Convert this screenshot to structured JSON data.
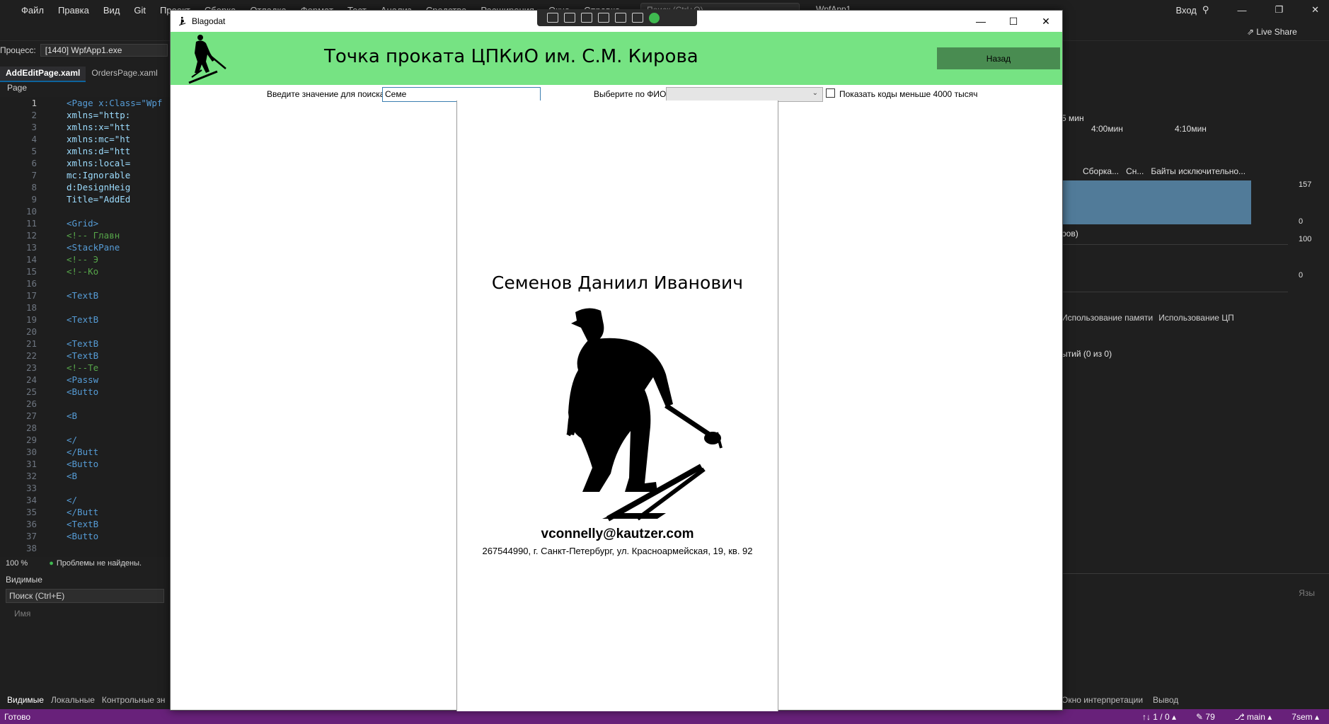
{
  "vs": {
    "menu": [
      "Файл",
      "Правка",
      "Вид",
      "Git",
      "Проект",
      "Сборка",
      "Отладка",
      "Формат",
      "Тест",
      "Анализ",
      "Средства",
      "Расширения",
      "Окно",
      "Справка"
    ],
    "search_placeholder": "Поиск (Ctrl+Q)",
    "solution": "WpfApp1",
    "signin": "Вход",
    "live_share": "Live Share",
    "process_label": "Процесс:",
    "process_value": "[1440] WpfApp1.exe",
    "tab_active": "AddEditPage.xaml",
    "tab_other": "OrdersPage.xaml",
    "breadcrumb": "Page",
    "code_lines": [
      {
        "n": "1",
        "t": "<Page x:Class=\"Wpf"
      },
      {
        "n": "2",
        "t": "      xmlns=\"http:"
      },
      {
        "n": "3",
        "t": "      xmlns:x=\"htt"
      },
      {
        "n": "4",
        "t": "      xmlns:mc=\"ht"
      },
      {
        "n": "5",
        "t": "      xmlns:d=\"htt"
      },
      {
        "n": "6",
        "t": "      xmlns:local="
      },
      {
        "n": "7",
        "t": "      mc:Ignorable"
      },
      {
        "n": "8",
        "t": "      d:DesignHeig"
      },
      {
        "n": "9",
        "t": "      Title=\"AddEd"
      },
      {
        "n": "10",
        "t": ""
      },
      {
        "n": "11",
        "t": "  <Grid>"
      },
      {
        "n": "12",
        "t": "    <!-- Главн"
      },
      {
        "n": "13",
        "t": "    <StackPane"
      },
      {
        "n": "14",
        "t": "      <!-- Э"
      },
      {
        "n": "15",
        "t": "      <!--Ко"
      },
      {
        "n": "16",
        "t": ""
      },
      {
        "n": "17",
        "t": "      <TextB"
      },
      {
        "n": "18",
        "t": ""
      },
      {
        "n": "19",
        "t": "      <TextB"
      },
      {
        "n": "20",
        "t": ""
      },
      {
        "n": "21",
        "t": "      <TextB"
      },
      {
        "n": "22",
        "t": "      <TextB"
      },
      {
        "n": "23",
        "t": "      <!--Те"
      },
      {
        "n": "24",
        "t": "      <Passw"
      },
      {
        "n": "25",
        "t": "      <Butto"
      },
      {
        "n": "26",
        "t": ""
      },
      {
        "n": "27",
        "t": "        <B"
      },
      {
        "n": "28",
        "t": ""
      },
      {
        "n": "29",
        "t": "        </"
      },
      {
        "n": "30",
        "t": "      </Butt"
      },
      {
        "n": "31",
        "t": "      <Butto"
      },
      {
        "n": "32",
        "t": "        <B"
      },
      {
        "n": "33",
        "t": ""
      },
      {
        "n": "34",
        "t": "        </"
      },
      {
        "n": "35",
        "t": "      </Butt"
      },
      {
        "n": "36",
        "t": "      <TextB"
      },
      {
        "n": "37",
        "t": "      <Butto"
      },
      {
        "n": "38",
        "t": ""
      }
    ],
    "zoom": "100 %",
    "no_issues": "Проблемы не найдены.",
    "locals_title": "Видимые",
    "locals_search": "Поиск (Ctrl+E)",
    "locals_col": "Имя",
    "bottom_tabs": [
      "Видимые",
      "Локальные",
      "Контрольные зн"
    ],
    "status_ready": "Готово",
    "status_right": [
      "↑↓ 1 / 0 ▴",
      "✎ 79",
      "⎇ main ▴",
      "7sem ▴"
    ],
    "diag": {
      "time1": "5 мин",
      "time2": "4:00мин",
      "time3": "4:10мин",
      "legend": [
        "Сборка...",
        "Сн...",
        "Байты исключительно..."
      ],
      "mem_max": "157",
      "mem_min": "0",
      "cpu_label": "ров)",
      "cpu_max": "100",
      "cpu_min": "0",
      "tab_mem": "Использование памяти",
      "tab_cpu": "Использование ЦП",
      "events": "ытий (0 из 0)",
      "bottom_col": "Язы",
      "bottom_tabs": [
        "Окно интерпретации",
        "Вывод"
      ]
    }
  },
  "app": {
    "window_title": "Blagodat",
    "header_title": "Точка проката ЦПКиО им. С.М. Кирова",
    "back_label": "Назад",
    "search_label": "Введите значение для поиска",
    "search_value": "Семе",
    "fio_label": "Выберите по ФИО",
    "fio_selected": "",
    "checkbox_label": "Показать коды меньше 4000 тысяч",
    "checkbox_checked": false,
    "client": {
      "name": "Семенов Даниил Иванович",
      "email": "vconnelly@kautzer.com",
      "address": "267544990, г. Санкт-Петербург, ул. Красноармейская, 19, кв. 92"
    }
  },
  "colors": {
    "header_green": "#76e383",
    "button_green": "#498c51",
    "vs_status": "#68217a"
  }
}
